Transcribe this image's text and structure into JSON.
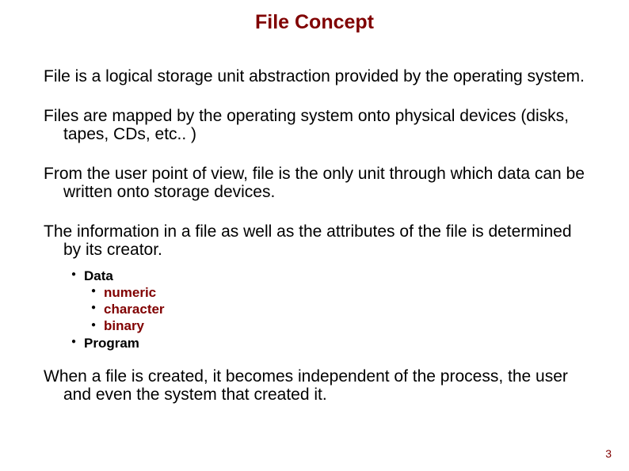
{
  "title": "File Concept",
  "p1": "File is a logical storage unit abstraction provided by the operating system.",
  "p2": "Files are mapped by the operating system onto physical devices (disks, tapes, CDs, etc.. )",
  "p3": "From the user point of view, file is the only unit through which data can be written onto storage devices.",
  "p4": "The information in a file as well as the attributes of the file is determined by its creator.",
  "b1": "Data",
  "b1a": "numeric",
  "b1b": "character",
  "b1c": "binary",
  "b2": "Program",
  "p5": "When a file is created, it becomes independent of the process, the user and even the system that created it.",
  "page_number": "3"
}
